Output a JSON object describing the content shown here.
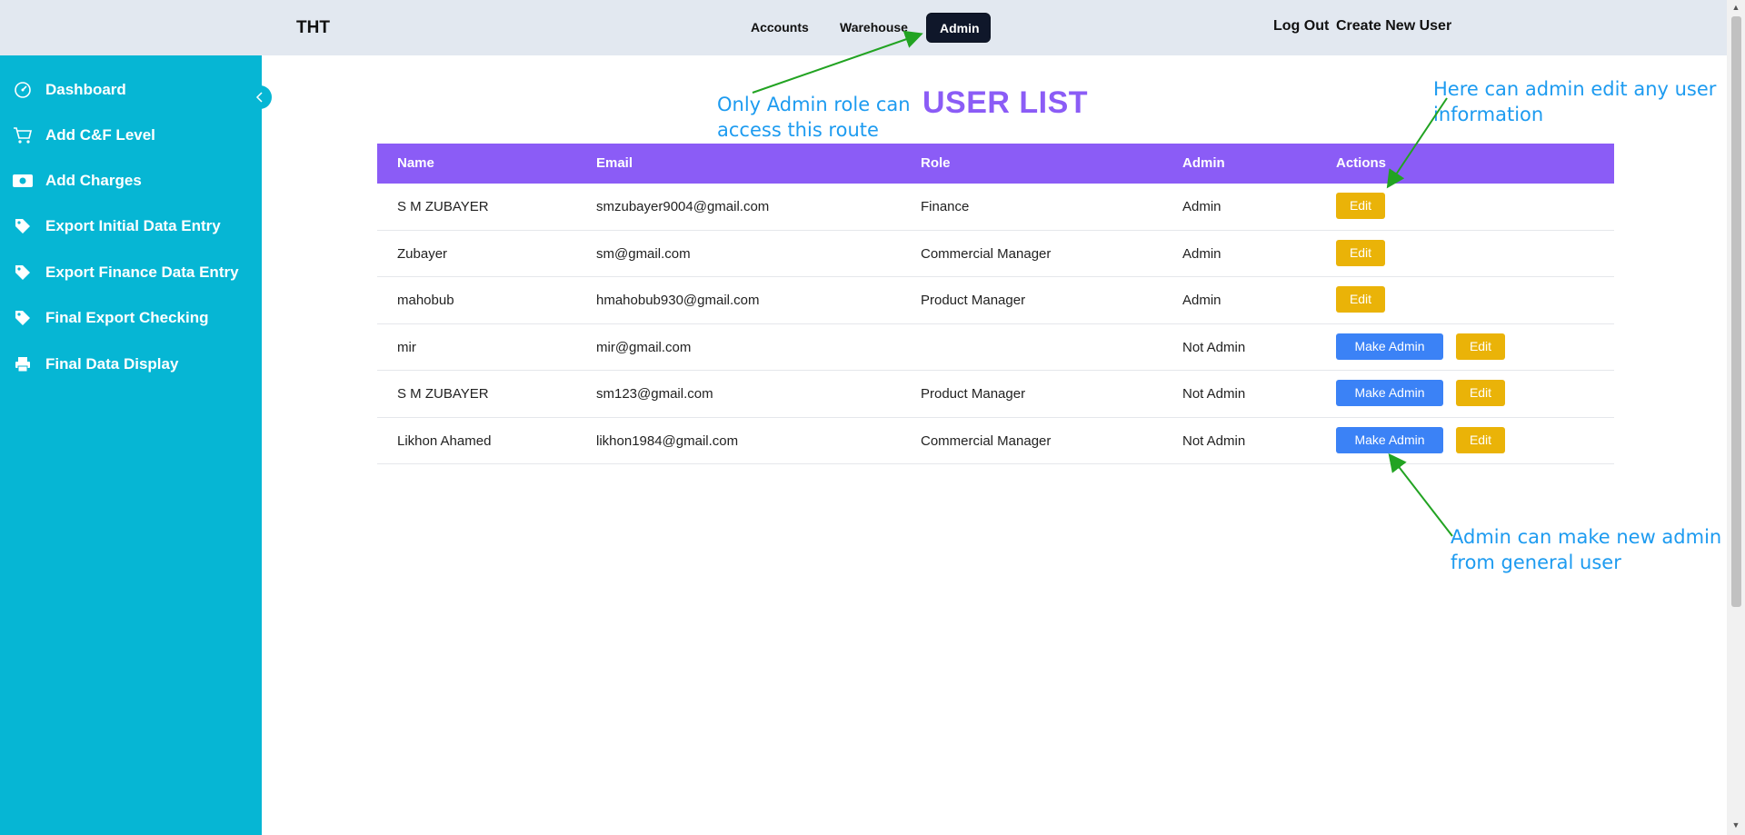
{
  "header": {
    "brand": "THT",
    "nav": [
      "Accounts",
      "Warehouse",
      "Admin"
    ],
    "active_nav": "Admin",
    "logout": "Log Out",
    "create_user": "Create New User"
  },
  "sidebar": {
    "items": [
      {
        "label": "Dashboard",
        "icon": "gauge-icon"
      },
      {
        "label": "Add C&F Level",
        "icon": "cart-icon"
      },
      {
        "label": "Add Charges",
        "icon": "money-icon"
      },
      {
        "label": "Export Initial Data Entry",
        "icon": "tag-icon"
      },
      {
        "label": "Export Finance Data Entry",
        "icon": "tag-icon"
      },
      {
        "label": "Final Export Checking",
        "icon": "tag-icon"
      },
      {
        "label": "Final Data Display",
        "icon": "printer-icon"
      }
    ]
  },
  "page": {
    "title": "USER LIST"
  },
  "table": {
    "headers": [
      "Name",
      "Email",
      "Role",
      "Admin",
      "Actions"
    ],
    "rows": [
      {
        "name": "S M ZUBAYER",
        "email": "smzubayer9004@gmail.com",
        "role": "Finance",
        "admin": "Admin",
        "make_admin": ""
      },
      {
        "name": "Zubayer",
        "email": "sm@gmail.com",
        "role": "Commercial Manager",
        "admin": "Admin",
        "make_admin": ""
      },
      {
        "name": "mahobub",
        "email": "hmahobub930@gmail.com",
        "role": "Product Manager",
        "admin": "Admin",
        "make_admin": ""
      },
      {
        "name": "mir",
        "email": "mir@gmail.com",
        "role": "",
        "admin": "Not Admin",
        "make_admin": "Make Admin"
      },
      {
        "name": "S M ZUBAYER",
        "email": "sm123@gmail.com",
        "role": "Product Manager",
        "admin": "Not Admin",
        "make_admin": "Make Admin"
      },
      {
        "name": "Likhon Ahamed",
        "email": "likhon1984@gmail.com",
        "role": "Commercial Manager",
        "admin": "Not Admin",
        "make_admin": "Make Admin"
      }
    ],
    "edit_label": "Edit"
  },
  "annotations": {
    "route_note": [
      "Only Admin role can",
      "access this route"
    ],
    "edit_note": [
      "Here can admin edit any user",
      "information"
    ],
    "make_admin_note": [
      "Admin can make new admin",
      "from general user"
    ]
  },
  "colors": {
    "topbar": "#e2e8f0",
    "sidebar": "#06b6d4",
    "table_header": "#8b5cf6",
    "edit_button": "#eab308",
    "make_admin_button": "#3b82f6",
    "annotation_text": "#1d9bf0",
    "annotation_arrow": "#22a322"
  }
}
